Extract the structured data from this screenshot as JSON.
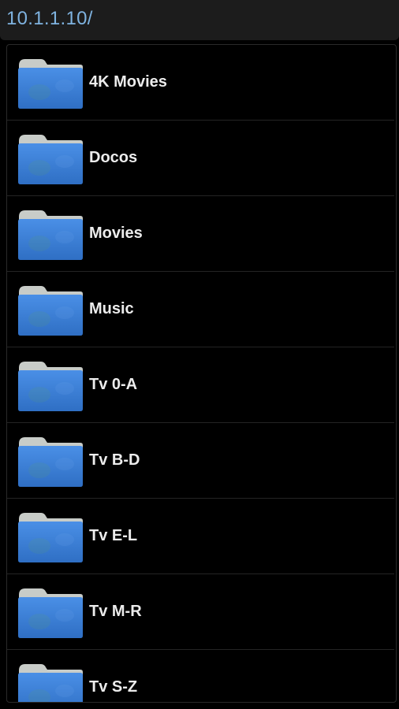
{
  "header": {
    "path": "10.1.1.10/"
  },
  "folders": [
    {
      "name": "4K Movies",
      "icon": "folder-icon"
    },
    {
      "name": "Docos",
      "icon": "folder-icon"
    },
    {
      "name": "Movies",
      "icon": "folder-icon"
    },
    {
      "name": "Music",
      "icon": "folder-icon"
    },
    {
      "name": "Tv 0-A",
      "icon": "folder-icon"
    },
    {
      "name": "Tv B-D",
      "icon": "folder-icon"
    },
    {
      "name": "Tv E-L",
      "icon": "folder-icon"
    },
    {
      "name": "Tv M-R",
      "icon": "folder-icon"
    },
    {
      "name": "Tv S-Z",
      "icon": "folder-icon"
    }
  ],
  "colors": {
    "folder_body": "#3d7fd6",
    "folder_tab": "#c8ccc8",
    "path_text": "#7fb3e0"
  }
}
